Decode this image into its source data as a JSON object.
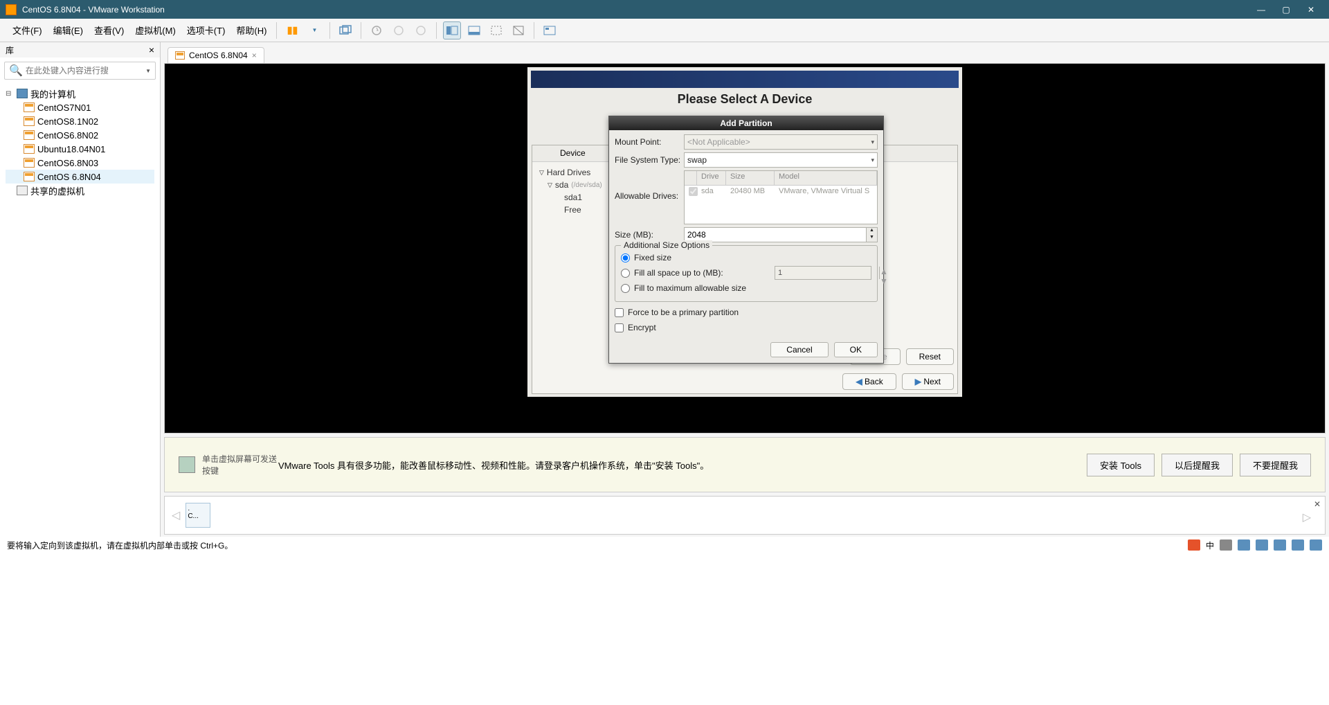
{
  "titlebar": {
    "text": "CentOS 6.8N04 - VMware Workstation"
  },
  "menu": [
    "文件(F)",
    "编辑(E)",
    "查看(V)",
    "虚拟机(M)",
    "选项卡(T)",
    "帮助(H)"
  ],
  "library": {
    "title": "库",
    "search_placeholder": "在此处键入内容进行搜",
    "root": "我的计算机",
    "vms": [
      "CentOS7N01",
      "CentOS8.1N02",
      "CentOS6.8N02",
      "Ubuntu18.04N01",
      "CentOS6.8N03",
      "CentOS 6.8N04"
    ],
    "shared": "共享的虚拟机"
  },
  "tab": {
    "label": "CentOS 6.8N04"
  },
  "installer": {
    "heading": "Please Select A Device",
    "device_col": "Device",
    "tree": {
      "hd": "Hard Drives",
      "sda": "sda",
      "sda_sub": "(/dev/sda)",
      "sda1": "sda1",
      "free": "Free"
    },
    "delete": "Delete",
    "reset": "Reset",
    "back": "Back",
    "next": "Next"
  },
  "dialog": {
    "title": "Add Partition",
    "mount_label": "Mount Point:",
    "mount_value": "<Not Applicable>",
    "fstype_label": "File System Type:",
    "fstype_value": "swap",
    "allowdrives_label": "Allowable Drives:",
    "drive_head": {
      "drive": "Drive",
      "size": "Size",
      "model": "Model"
    },
    "drive_row": {
      "name": "sda",
      "size": "20480 MB",
      "model": "VMware, VMware Virtual S"
    },
    "size_label": "Size (MB):",
    "size_value": "2048",
    "addl": "Additional Size Options",
    "fixed": "Fixed size",
    "fillup": "Fill all space up to (MB):",
    "fillup_val": "1",
    "fillmax": "Fill to maximum allowable size",
    "primary": "Force to be a primary partition",
    "encrypt": "Encrypt",
    "cancel": "Cancel",
    "ok": "OK"
  },
  "infobar": {
    "hint": "单击虚拟屏幕可发送按键",
    "msg": "VMware Tools 具有很多功能，能改善鼠标移动性、视频和性能。请登录客户机操作系统，单击\"安装 Tools\"。",
    "b1": "安装 Tools",
    "b2": "以后提醒我",
    "b3": "不要提醒我"
  },
  "thumb": {
    "dot": ".",
    "label": "C..."
  },
  "statusbar": {
    "msg": "要将输入定向到该虚拟机，请在虚拟机内部单击或按 Ctrl+G。",
    "ch": "中"
  }
}
